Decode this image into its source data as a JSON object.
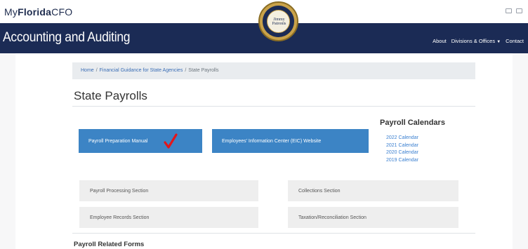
{
  "header": {
    "brand_prefix": "My",
    "brand_bold": "Florida",
    "brand_suffix": "CFO",
    "icons": [
      "window-icon",
      "window-icon"
    ]
  },
  "seal": {
    "name_line1": "Jimmy",
    "name_line2": "Patronis"
  },
  "navbar": {
    "title": "Accounting and Auditing",
    "links": [
      "About",
      "Divisions & Offices",
      "Contact"
    ],
    "dropdown_caret": "▼"
  },
  "breadcrumb": {
    "items": [
      "Home",
      "Financial Guidance for State Agencies",
      "State Payrolls"
    ],
    "separator": "/"
  },
  "page": {
    "title": "State Payrolls"
  },
  "main_buttons": {
    "manual": "Payroll Preparation Manual",
    "eic": "Employees' Information Center (EIC) Website"
  },
  "annotation": {
    "checkmark_color": "#e3161b"
  },
  "calendars": {
    "heading": "Payroll Calendars",
    "links": [
      "2022 Calendar",
      "2021 Calendar",
      "2020 Calendar",
      "2019 Calendar"
    ]
  },
  "sections": {
    "processing": "Payroll Processing Section",
    "collections": "Collections Section",
    "employee_records": "Employee Records Section",
    "taxation": "Taxation/Reconciliation Section"
  },
  "forms": {
    "heading": "Payroll Related Forms"
  },
  "colors": {
    "navbar_bg": "#1b2b55",
    "button_blue": "#3c84c5",
    "link_blue": "#3a7fd0",
    "section_gray": "#eeeeee"
  }
}
